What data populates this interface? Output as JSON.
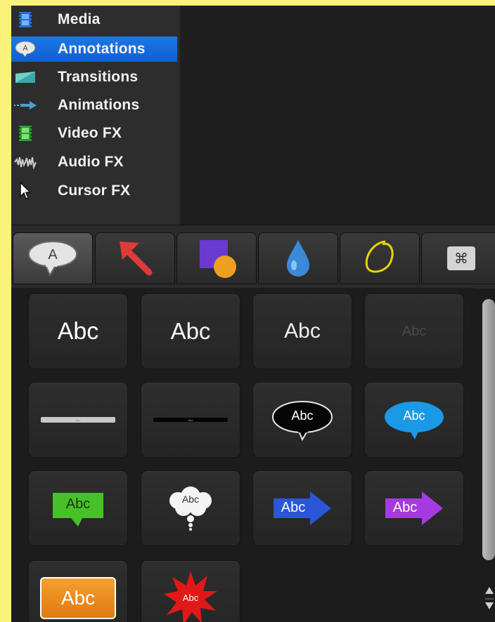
{
  "sidebar": {
    "items": [
      {
        "label": "Media",
        "icon": "media-filmstrip-icon"
      },
      {
        "label": "Annotations",
        "icon": "annotations-bubble-icon",
        "selected": true
      },
      {
        "label": "Transitions",
        "icon": "transitions-icon"
      },
      {
        "label": "Animations",
        "icon": "animations-arrow-icon"
      },
      {
        "label": "Video FX",
        "icon": "video-fx-icon"
      },
      {
        "label": "Audio FX",
        "icon": "audio-fx-waveform-icon"
      },
      {
        "label": "Cursor FX",
        "icon": "cursor-fx-pointer-icon"
      }
    ]
  },
  "tabs": [
    {
      "name": "callouts",
      "icon": "speech-bubble-icon",
      "glyph": "A",
      "active": true
    },
    {
      "name": "arrows",
      "icon": "arrow-icon"
    },
    {
      "name": "shapes",
      "icon": "shapes-icon"
    },
    {
      "name": "blur-highlight",
      "icon": "drop-icon"
    },
    {
      "name": "sketch-motion",
      "icon": "sketch-circle-icon"
    },
    {
      "name": "keystroke",
      "icon": "command-key-icon",
      "glyph": "⌘"
    }
  ],
  "callouts": {
    "text": "Abc",
    "tiles": [
      {
        "type": "text-white",
        "label": "Abc"
      },
      {
        "type": "text-white-light",
        "label": "Abc"
      },
      {
        "type": "text-white-small",
        "label": "Abc"
      },
      {
        "type": "text-faded",
        "label": "Abc"
      },
      {
        "type": "lower-third-gray",
        "label": "Abc"
      },
      {
        "type": "lower-third-black",
        "label": "Abc"
      },
      {
        "type": "speech-black",
        "label": "Abc"
      },
      {
        "type": "speech-blue",
        "label": "Abc"
      },
      {
        "type": "speech-green",
        "label": "Abc"
      },
      {
        "type": "thought-cloud",
        "label": "Abc"
      },
      {
        "type": "arrow-blue",
        "label": "Abc"
      },
      {
        "type": "arrow-purple",
        "label": "Abc"
      },
      {
        "type": "box-orange",
        "label": "Abc"
      },
      {
        "type": "burst-red",
        "label": "Abc"
      }
    ]
  },
  "colors": {
    "selection": "#1a6fe0",
    "background": "#fbf27a",
    "panel": "#1c1c1c"
  }
}
